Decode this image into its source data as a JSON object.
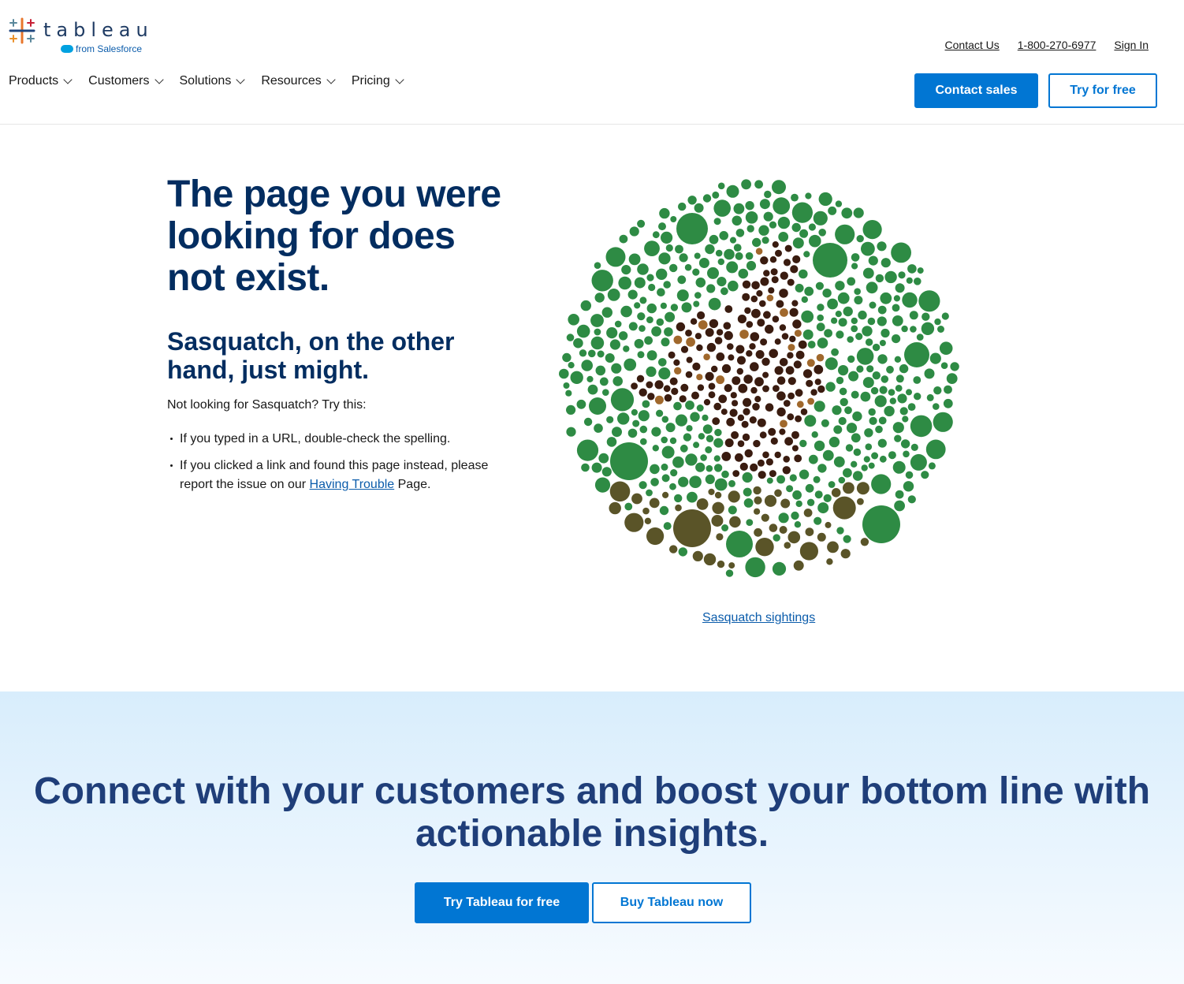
{
  "brand": {
    "logo_word": "tableau",
    "logo_sub": "from Salesforce",
    "colors": {
      "primary": "#0176d3",
      "navy": "#032d60",
      "link": "#0b5cab",
      "band": "#d8edfc"
    }
  },
  "header": {
    "utility_links": [
      "Contact Us",
      "1-800-270-6977",
      "Sign In"
    ],
    "nav": [
      "Products",
      "Customers",
      "Solutions",
      "Resources",
      "Pricing"
    ],
    "contact_sales": "Contact sales",
    "try_free": "Try for free"
  },
  "main": {
    "headline": "The page you were looking for does not exist.",
    "subhead": "Sasquatch, on the other hand, just might.",
    "intro": "Not looking for Sasquatch? Try this:",
    "tip1": "If you typed in a URL, double-check the spelling.",
    "tip2_before": "If you clicked a link and found this page instead, please report the issue on our",
    "tip2_link": "Having Trouble",
    "tip2_after": "Page.",
    "viz_link": "Sasquatch sightings",
    "viz_colors": {
      "green": "#2e8b44",
      "dark_brown": "#3a1c10",
      "brown": "#a0682c",
      "olive": "#5a5428"
    }
  },
  "cta": {
    "title": "Connect with your customers and boost your bottom line with actionable insights.",
    "try_button": "Try Tableau for free",
    "buy_button": "Buy Tableau now"
  }
}
